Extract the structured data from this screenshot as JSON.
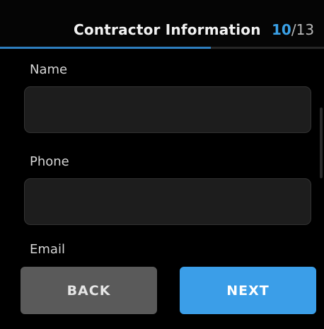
{
  "header": {
    "title": "Contractor Information",
    "step_current": "10",
    "step_separator": "/",
    "step_total": "13",
    "progress_fraction": 0.65
  },
  "form": {
    "fields": [
      {
        "label": "Name",
        "value": ""
      },
      {
        "label": "Phone",
        "value": ""
      },
      {
        "label": "Email",
        "value": ""
      }
    ]
  },
  "footer": {
    "back_label": "BACK",
    "next_label": "NEXT"
  },
  "colors": {
    "accent": "#3b9ee8",
    "background": "#000000",
    "input_background": "#1d1d1d",
    "back_button": "#5a5a5a"
  }
}
